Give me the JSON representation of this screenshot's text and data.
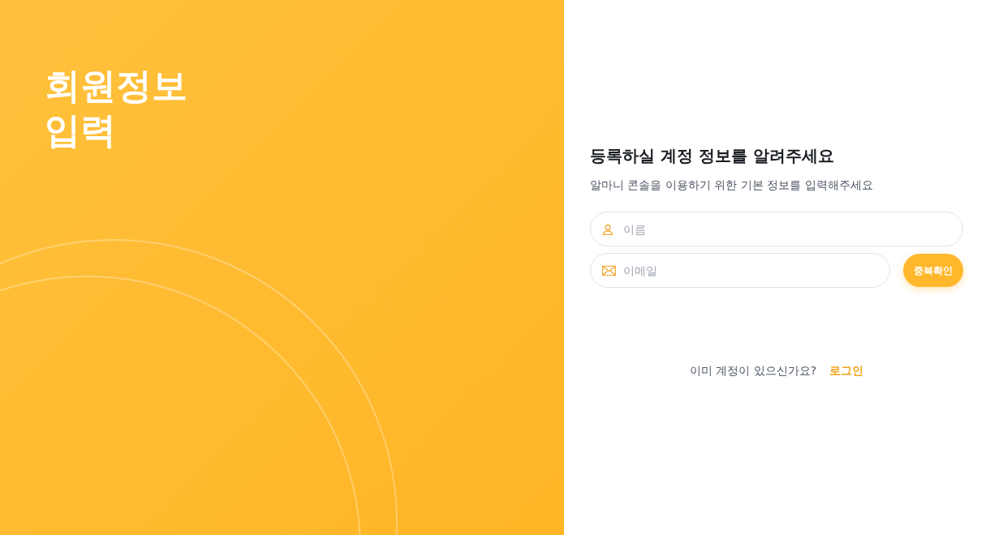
{
  "hero": {
    "title_lines": [
      "회원정보",
      "입력"
    ]
  },
  "form": {
    "heading": "등록하실 계정 정보를 알려주세요",
    "subheading": "알마니 콘솔을 이용하기 위한 기본 정보를 입력해주세요",
    "fields": [
      {
        "kind": "person",
        "placeholder": "이름"
      },
      {
        "kind": "email",
        "placeholder": "이메일",
        "button": "중복확인"
      }
    ]
  },
  "footer": {
    "question": "이미 계정이 있으신가요?",
    "link": "로그인"
  }
}
